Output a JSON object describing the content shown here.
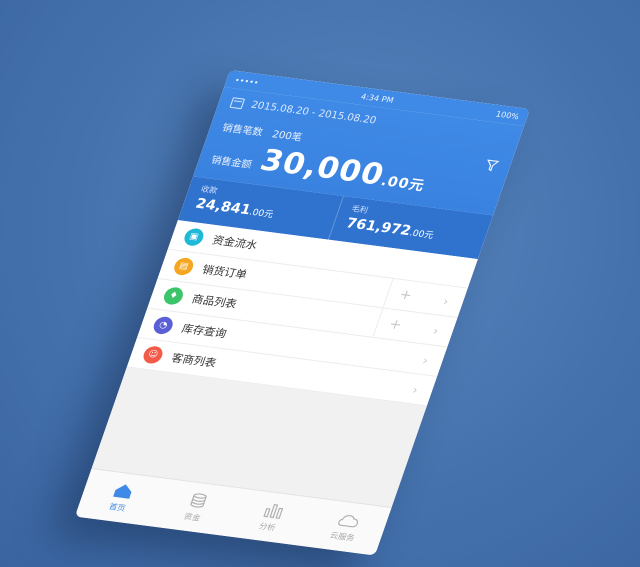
{
  "status_bar": {
    "carrier": "••••• ",
    "time": "4:34 PM",
    "battery": "100%"
  },
  "header": {
    "date_range": "2015.08.20 - 2015.08.20",
    "sales_count_label": "销售笔数",
    "sales_count_value": "200笔",
    "sales_amount_label": "销售金额",
    "sales_amount_main": "30,000",
    "sales_amount_decimal": ".00元"
  },
  "totals": {
    "received_label": "收款",
    "received_main": "24,841",
    "received_decimal": ".00元",
    "profit_label": "毛利",
    "profit_main": "761,972",
    "profit_decimal": ".00元"
  },
  "menu": [
    {
      "label": "资金流水",
      "icon": "wallet-icon",
      "color": "#1fb8d6",
      "glyph": "▣",
      "plus": false
    },
    {
      "label": "销货订单",
      "icon": "order-icon",
      "color": "#f5a623",
      "glyph": "▤",
      "plus": true
    },
    {
      "label": "商品列表",
      "icon": "shirt-icon",
      "color": "#3cc46a",
      "glyph": "♦",
      "plus": true
    },
    {
      "label": "库存查询",
      "icon": "chart-pie-icon",
      "color": "#5a5fd6",
      "glyph": "◔",
      "plus": false
    },
    {
      "label": "客商列表",
      "icon": "customer-icon",
      "color": "#f25a4a",
      "glyph": "☺",
      "plus": false
    }
  ],
  "tabs": [
    {
      "label": "首页",
      "icon": "home-icon",
      "active": true
    },
    {
      "label": "资金",
      "icon": "coins-icon",
      "active": false
    },
    {
      "label": "分析",
      "icon": "bars-icon",
      "active": false
    },
    {
      "label": "云服务",
      "icon": "cloud-icon",
      "active": false
    }
  ],
  "colors": {
    "primary": "#3f8ae6",
    "primary_dark": "#2f73cf",
    "background": "#4572ad"
  }
}
